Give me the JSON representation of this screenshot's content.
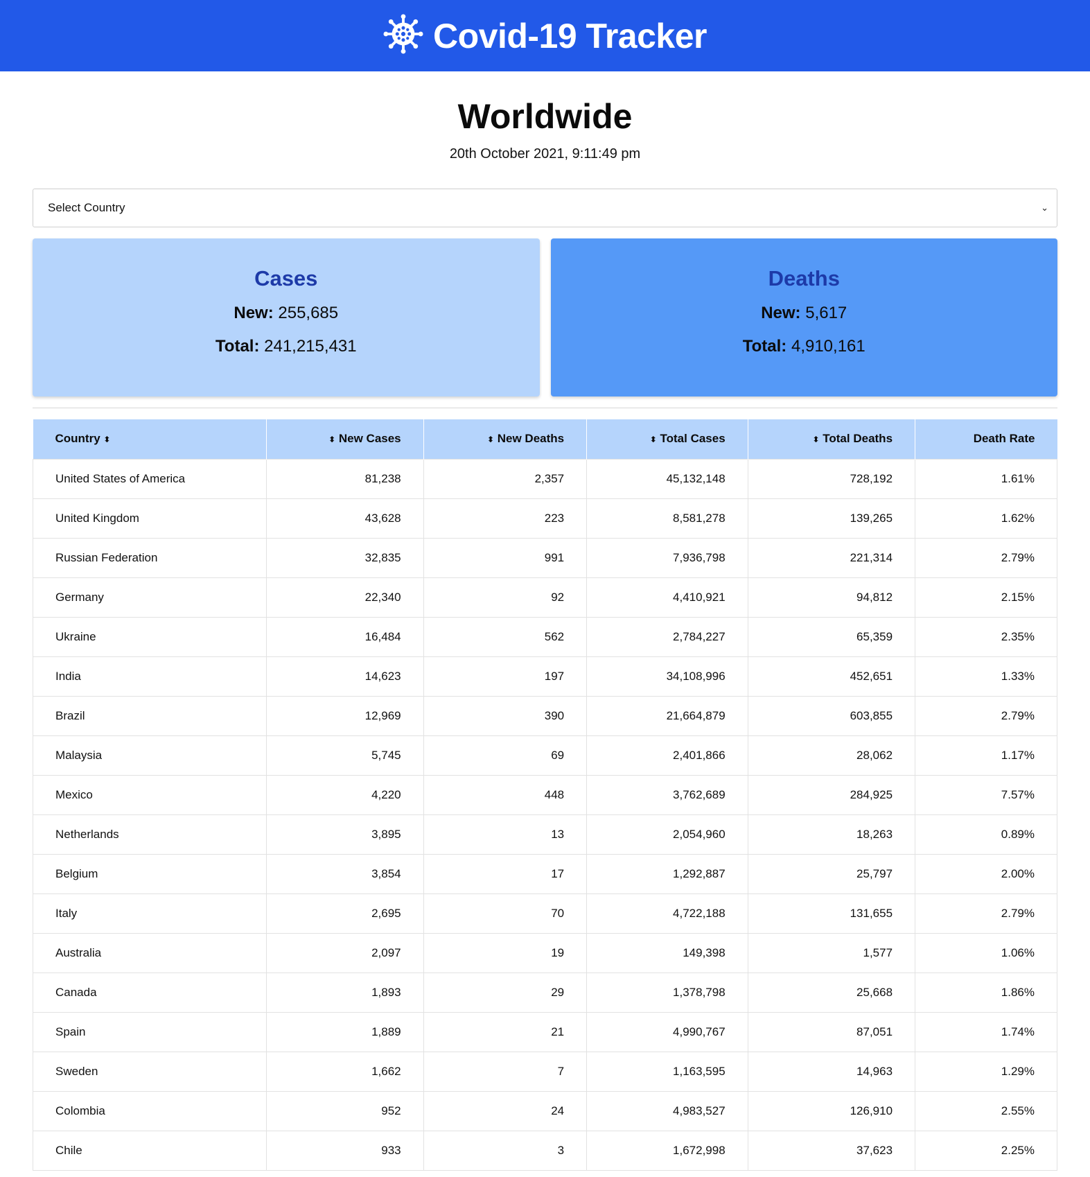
{
  "header": {
    "title": "Covid-19 Tracker",
    "icon": "virus-icon"
  },
  "region": {
    "title": "Worldwide",
    "timestamp": "20th October 2021, 9:11:49 pm"
  },
  "select": {
    "value": "Select Country"
  },
  "cards": {
    "cases": {
      "title": "Cases",
      "new_label": "New:",
      "new_value": "255,685",
      "total_label": "Total:",
      "total_value": "241,215,431"
    },
    "deaths": {
      "title": "Deaths",
      "new_label": "New:",
      "new_value": "5,617",
      "total_label": "Total:",
      "total_value": "4,910,161"
    }
  },
  "colors": {
    "header": "#2259e8",
    "cases_card": "#b5d4fc",
    "deaths_card": "#5599f7",
    "card_title": "#1d3aa8",
    "table_header": "#b5d4fc"
  },
  "table": {
    "columns": [
      "Country",
      "New Cases",
      "New Deaths",
      "Total Cases",
      "Total Deaths",
      "Death Rate"
    ],
    "rows": [
      [
        "United States of America",
        "81,238",
        "2,357",
        "45,132,148",
        "728,192",
        "1.61%"
      ],
      [
        "United Kingdom",
        "43,628",
        "223",
        "8,581,278",
        "139,265",
        "1.62%"
      ],
      [
        "Russian Federation",
        "32,835",
        "991",
        "7,936,798",
        "221,314",
        "2.79%"
      ],
      [
        "Germany",
        "22,340",
        "92",
        "4,410,921",
        "94,812",
        "2.15%"
      ],
      [
        "Ukraine",
        "16,484",
        "562",
        "2,784,227",
        "65,359",
        "2.35%"
      ],
      [
        "India",
        "14,623",
        "197",
        "34,108,996",
        "452,651",
        "1.33%"
      ],
      [
        "Brazil",
        "12,969",
        "390",
        "21,664,879",
        "603,855",
        "2.79%"
      ],
      [
        "Malaysia",
        "5,745",
        "69",
        "2,401,866",
        "28,062",
        "1.17%"
      ],
      [
        "Mexico",
        "4,220",
        "448",
        "3,762,689",
        "284,925",
        "7.57%"
      ],
      [
        "Netherlands",
        "3,895",
        "13",
        "2,054,960",
        "18,263",
        "0.89%"
      ],
      [
        "Belgium",
        "3,854",
        "17",
        "1,292,887",
        "25,797",
        "2.00%"
      ],
      [
        "Italy",
        "2,695",
        "70",
        "4,722,188",
        "131,655",
        "2.79%"
      ],
      [
        "Australia",
        "2,097",
        "19",
        "149,398",
        "1,577",
        "1.06%"
      ],
      [
        "Canada",
        "1,893",
        "29",
        "1,378,798",
        "25,668",
        "1.86%"
      ],
      [
        "Spain",
        "1,889",
        "21",
        "4,990,767",
        "87,051",
        "1.74%"
      ],
      [
        "Sweden",
        "1,662",
        "7",
        "1,163,595",
        "14,963",
        "1.29%"
      ],
      [
        "Colombia",
        "952",
        "24",
        "4,983,527",
        "126,910",
        "2.55%"
      ],
      [
        "Chile",
        "933",
        "3",
        "1,672,998",
        "37,623",
        "2.25%"
      ]
    ]
  }
}
